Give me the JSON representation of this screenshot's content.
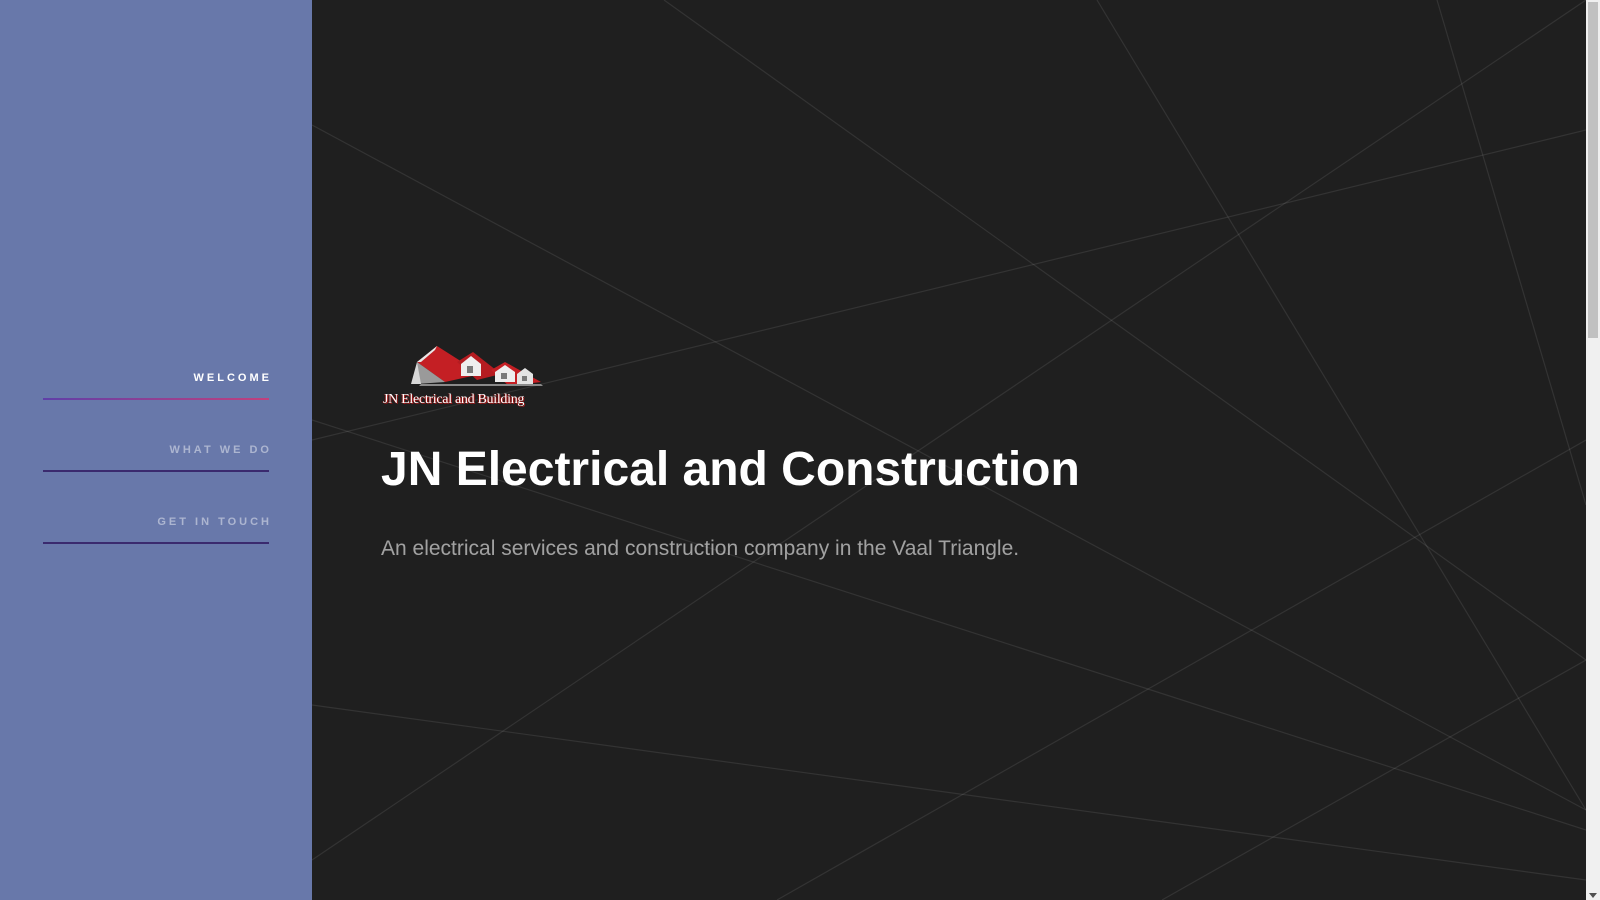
{
  "sidebar": {
    "background_color": "#6878aa",
    "nav": [
      {
        "label": "WELCOME",
        "active": true
      },
      {
        "label": "WHAT WE DO",
        "active": false
      },
      {
        "label": "GET IN TOUCH",
        "active": false
      }
    ]
  },
  "hero": {
    "logo_text": "JN Electrical and Building",
    "title": "JN Electrical and Construction",
    "subtitle": "An electrical services and construction company in the Vaal Triangle."
  },
  "colors": {
    "main_background": "#1f1f1f",
    "accent_gradient_start": "#5f3fa8",
    "accent_gradient_end": "#c2407d",
    "inactive_underline": "#3a2a6e",
    "logo_roof": "#c41f24"
  }
}
